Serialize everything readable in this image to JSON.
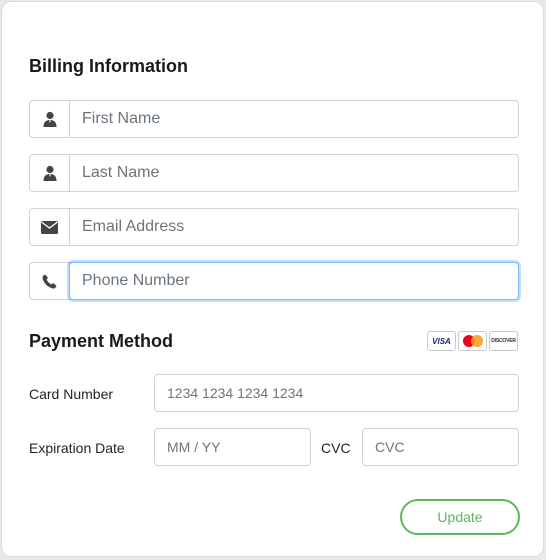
{
  "billing": {
    "title": "Billing Information",
    "first_name_placeholder": "First Name",
    "last_name_placeholder": "Last Name",
    "email_placeholder": "Email Address",
    "phone_placeholder": "Phone Number"
  },
  "payment": {
    "title": "Payment Method",
    "card_icons": {
      "visa": "VISA",
      "discover": "DISCOVER"
    },
    "card_number_label": "Card Number",
    "card_number_placeholder": "1234 1234 1234 1234",
    "expiration_label": "Expiration Date",
    "expiration_placeholder": "MM / YY",
    "cvc_label": "CVC",
    "cvc_placeholder": "CVC"
  },
  "actions": {
    "update_label": "Update"
  },
  "colors": {
    "accent_green": "#5cb85c",
    "focus_blue": "#80bdff",
    "icon_gray": "#444444"
  }
}
